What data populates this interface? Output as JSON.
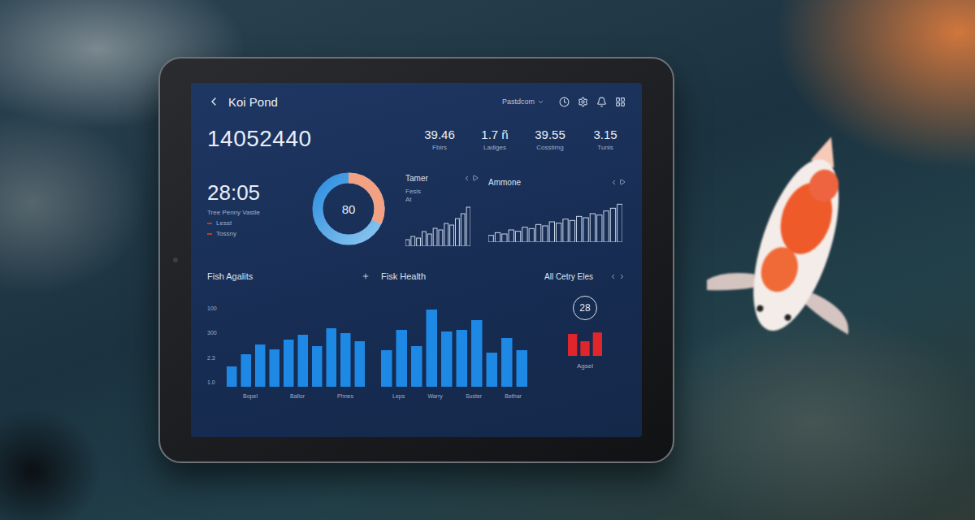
{
  "app": {
    "title": "Koi Pond",
    "account": "Pastdcom"
  },
  "total": "14052440",
  "stats": [
    {
      "value": "39.46",
      "label": "Fbirs"
    },
    {
      "value": "1.7 ñ",
      "label": "Ladiges"
    },
    {
      "value": "39.55",
      "label": "Cosstimg"
    },
    {
      "value": "3.15",
      "label": "Tunis"
    }
  ],
  "timer": {
    "time": "28:05",
    "label": "Tree Penny Vastle",
    "legend": [
      {
        "label": "Lesst",
        "color": "#c0392b"
      },
      {
        "label": "Tossny",
        "color": "#c0392b"
      }
    ]
  },
  "donut": {
    "value": "80",
    "level": 0.32
  },
  "mini_charts": [
    {
      "title": "Tamer",
      "notes": [
        "Fesis",
        "At"
      ],
      "values": [
        8,
        12,
        10,
        18,
        15,
        22,
        20,
        28,
        26,
        34,
        40,
        48
      ],
      "max": 50
    },
    {
      "title": "Ammone",
      "notes": [],
      "values": [
        10,
        14,
        12,
        18,
        16,
        22,
        20,
        26,
        24,
        30,
        28,
        34,
        32,
        38,
        36,
        42,
        40,
        46,
        50,
        56
      ],
      "max": 60
    }
  ],
  "panels": [
    {
      "title": "Fish Agalits",
      "ticks": [
        "100",
        "300",
        "2.3",
        "1.0"
      ],
      "labels": [
        "Bopel",
        "Ballor",
        "Phnes"
      ],
      "values": [
        25,
        40,
        52,
        46,
        58,
        64,
        50,
        72,
        66,
        56
      ],
      "max": 100,
      "color": "#1e88e5"
    },
    {
      "title": "Fisk Health",
      "ticks": [],
      "labels": [
        "Leps",
        "Warry",
        "Suster",
        "Bethar"
      ],
      "values": [
        45,
        70,
        50,
        95,
        68,
        70,
        82,
        42,
        60,
        45
      ],
      "max": 100,
      "color": "#1e88e5"
    }
  ],
  "side_panel": {
    "title": "All Cetry Eles",
    "badge": "28",
    "label": "Agsel",
    "values": [
      30,
      20,
      32
    ],
    "max": 40,
    "color": "#e0262b"
  }
}
